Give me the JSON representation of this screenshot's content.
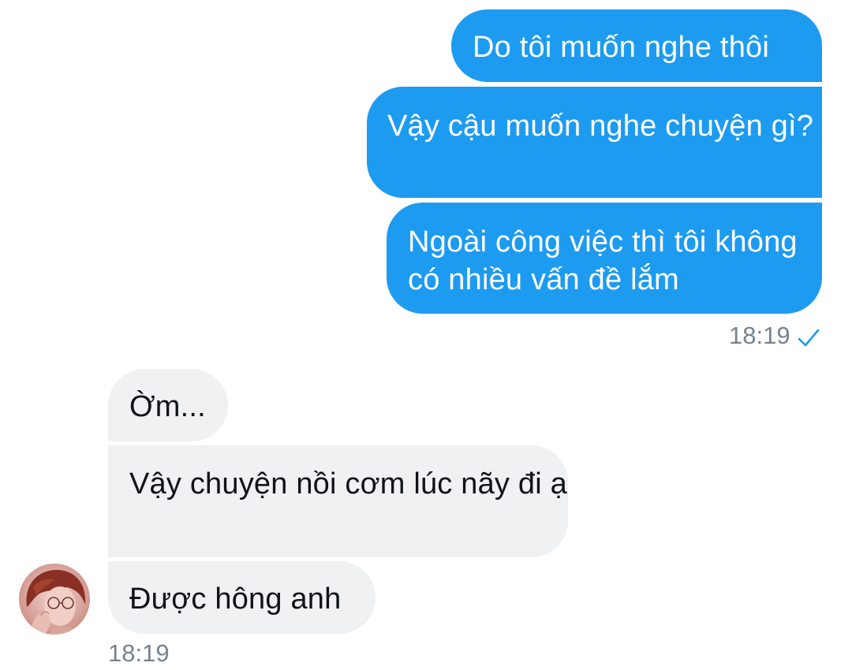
{
  "conversation": {
    "sent_messages": [
      {
        "text": "Do tôi muốn nghe thôi"
      },
      {
        "text": "Vậy cậu muốn nghe chuyện gì?"
      },
      {
        "text": "Ngoài công việc thì tôi không có nhiều vấn đề lắm"
      }
    ],
    "sent_time": "18:19",
    "sent_status_icon": "checkmark-icon",
    "received_messages": [
      {
        "text": "Ờm..."
      },
      {
        "text": "Vậy chuyện nồi cơm lúc nãy đi ạ"
      },
      {
        "text": "Được hông anh"
      }
    ],
    "received_time": "18:19",
    "avatar_icon": "contact-avatar"
  },
  "colors": {
    "sent_bubble": "#1d9bf0",
    "received_bubble": "#eff1f3",
    "timestamp": "#75838f",
    "text_dark": "#0f1419"
  }
}
